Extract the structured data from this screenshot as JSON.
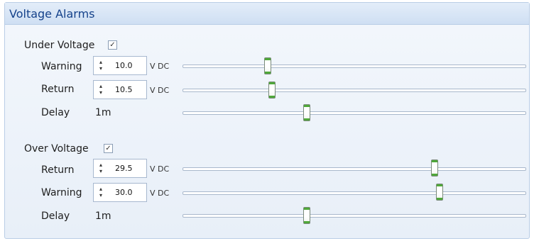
{
  "panel": {
    "title": "Voltage Alarms"
  },
  "under_voltage": {
    "label": "Under Voltage",
    "enabled": true,
    "rows": [
      {
        "label": "Warning",
        "value": "10.0",
        "unit": "V DC",
        "slider_fraction": 0.25
      },
      {
        "label": "Return",
        "value": "10.5",
        "unit": "V DC",
        "slider_fraction": 0.262
      },
      {
        "label": "Delay",
        "value": "1m",
        "slider_fraction": 0.362
      }
    ]
  },
  "over_voltage": {
    "label": "Over Voltage",
    "enabled": true,
    "rows": [
      {
        "label": "Return",
        "value": "29.5",
        "unit": "V DC",
        "slider_fraction": 0.73
      },
      {
        "label": "Warning",
        "value": "30.0",
        "unit": "V DC",
        "slider_fraction": 0.745
      },
      {
        "label": "Delay",
        "value": "1m",
        "slider_fraction": 0.362
      }
    ]
  },
  "colors": {
    "accent": "#4fa83a",
    "header_text": "#15428b",
    "border": "#b9cde6"
  },
  "icons": {
    "checkbox": "check-icon",
    "spinner": "up-down-arrows-icon"
  }
}
